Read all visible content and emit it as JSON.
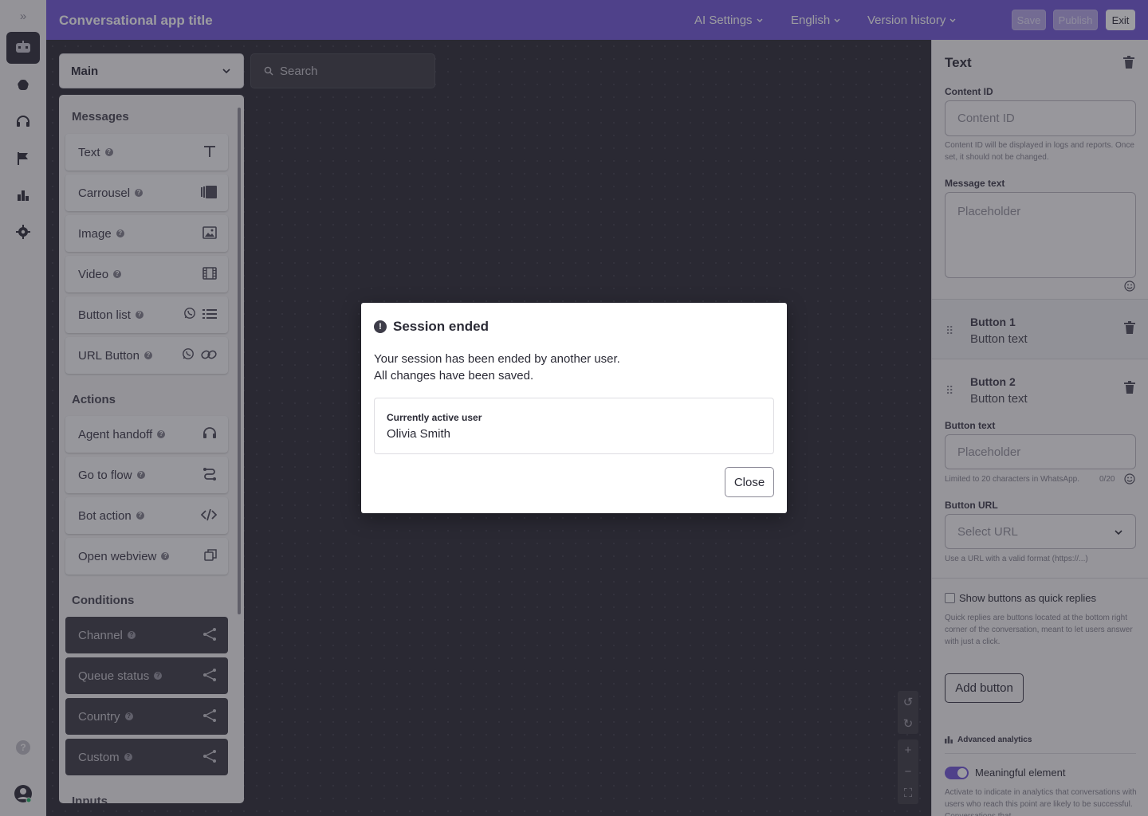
{
  "header": {
    "app_title": "Conversational app title",
    "ai_settings": "AI Settings",
    "language": "English",
    "version_history": "Version history",
    "save": "Save",
    "publish": "Publish",
    "exit": "Exit"
  },
  "rail": {
    "expand": "»",
    "items": [
      "bot-icon",
      "brain-icon",
      "headset-icon",
      "flag-icon",
      "bar-chart-icon",
      "gear-icon"
    ],
    "help": "?",
    "avatar": "user-avatar-icon"
  },
  "canvas": {
    "flow_select": "Main",
    "search_placeholder": "Search"
  },
  "palette": {
    "messages_title": "Messages",
    "messages": [
      "Text",
      "Carrousel",
      "Image",
      "Video",
      "Button list",
      "URL Button"
    ],
    "actions_title": "Actions",
    "actions": [
      "Agent handoff",
      "Go to flow",
      "Bot action",
      "Open webview"
    ],
    "conditions_title": "Conditions",
    "conditions": [
      "Channel",
      "Queue status",
      "Country",
      "Custom"
    ],
    "inputs_title": "Inputs"
  },
  "panel": {
    "title": "Text",
    "content_id_label": "Content ID",
    "content_id_placeholder": "Content ID",
    "content_id_hint": "Content ID will be displayed in logs and reports. Once set, it should not be changed.",
    "message_text_label": "Message text",
    "message_text_placeholder": "Placeholder",
    "button1_name": "Button 1",
    "button1_sub": "Button text",
    "button2_name": "Button 2",
    "button2_sub": "Button text",
    "button_text_label": "Button text",
    "button_text_placeholder": "Placeholder",
    "button_text_hint": "Limited to 20 characters in WhatsApp.",
    "button_text_counter": "0/20",
    "button_url_label": "Button URL",
    "button_url_placeholder": "Select URL",
    "button_url_hint": "Use a URL with a valid format (https://...)",
    "quick_replies_label": "Show buttons as quick replies",
    "quick_replies_hint": "Quick replies are buttons located at the bottom right corner of the conversation, meant to let users answer with just a click.",
    "add_button": "Add button",
    "advanced_analytics": "Advanced analytics",
    "meaningful_label": "Meaningful element",
    "meaningful_hint": "Activate to indicate in analytics that conversations with users who reach this point are likely to be successful. Conversations that"
  },
  "modal": {
    "title": "Session ended",
    "line1": "Your session has been ended by another user.",
    "line2": "All changes have been saved.",
    "card_label": "Currently active user",
    "card_value": "Olivia Smith",
    "close": "Close"
  },
  "colors": {
    "brand": "#7a62d9",
    "canvas": "#3b3a44",
    "panel": "#f4f3f5"
  }
}
